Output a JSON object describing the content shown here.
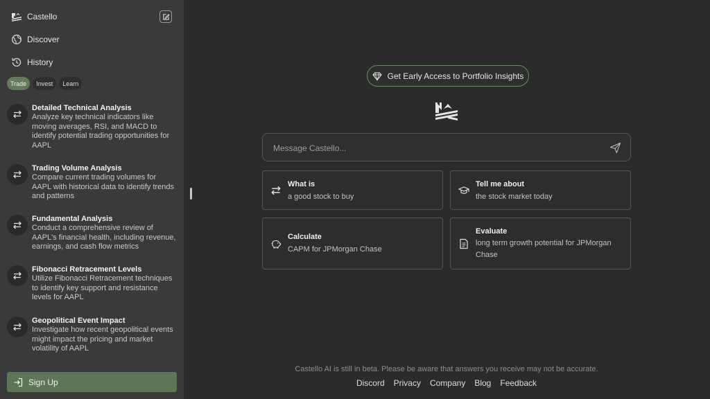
{
  "sidebar": {
    "brand": "Castello",
    "nav": [
      {
        "label": "Discover",
        "icon": "globe-icon"
      },
      {
        "label": "History",
        "icon": "history-icon"
      }
    ],
    "tabs": [
      {
        "label": "Trade",
        "active": true
      },
      {
        "label": "Invest",
        "active": false
      },
      {
        "label": "Learn",
        "active": false
      }
    ],
    "prompts": [
      {
        "title": "Detailed Technical Analysis",
        "desc": "Analyze key technical indicators like moving averages, RSI, and MACD to identify potential trading opportunities for AAPL"
      },
      {
        "title": "Trading Volume Analysis",
        "desc": "Compare current trading volumes for AAPL with historical data to identify trends and patterns"
      },
      {
        "title": "Fundamental Analysis",
        "desc": "Conduct a comprehensive review of AAPL's financial health, including revenue, earnings, and cash flow metrics"
      },
      {
        "title": "Fibonacci Retracement Levels",
        "desc": "Utilize Fibonacci Retracement techniques to identify key support and resistance levels for AAPL"
      },
      {
        "title": "Geopolitical Event Impact",
        "desc": "Investigate how recent geopolitical events might impact the pricing and market volatility of AAPL"
      }
    ],
    "signup_label": "Sign Up"
  },
  "main": {
    "early_access": "Get Early Access to Portfolio Insights",
    "message_placeholder": "Message Castello...",
    "cards": [
      {
        "title": "What is",
        "sub": "a good stock to buy",
        "icon": "swap-icon"
      },
      {
        "title": "Tell me about",
        "sub": "the stock market today",
        "icon": "graduation-cap-icon"
      },
      {
        "title": "Calculate",
        "sub": "CAPM for JPMorgan Chase",
        "icon": "piggy-bank-icon"
      },
      {
        "title": "Evaluate",
        "sub": "long term growth potential for JPMorgan Chase",
        "icon": "document-icon"
      }
    ],
    "disclaimer": "Castello AI is still in beta. Please be aware that answers you receive may not be accurate.",
    "footer_links": [
      "Discord",
      "Privacy",
      "Company",
      "Blog",
      "Feedback"
    ]
  },
  "colors": {
    "sidebar_bg": "#3a3a3a",
    "main_bg": "#2b2b2b",
    "accent_green": "#5f7557"
  }
}
